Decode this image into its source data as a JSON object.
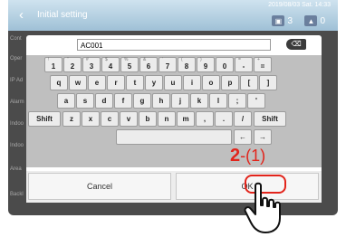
{
  "header": {
    "title": "Initial setting",
    "datetime": "2019/08/03 Sat. 14:33",
    "badge1_count": "3",
    "badge2_count": "0"
  },
  "sidebar": {
    "items": [
      "Cont",
      "Oper",
      "IP Ad",
      "Alarm",
      "Indoo",
      "Indoo",
      "Area",
      "Backl"
    ]
  },
  "keyboard": {
    "input_value": "AC001",
    "backspace_label": "⌫",
    "row1": [
      {
        "main": "1",
        "sub": "!"
      },
      {
        "main": "2",
        "sub": "\""
      },
      {
        "main": "3",
        "sub": "#"
      },
      {
        "main": "4",
        "sub": "$"
      },
      {
        "main": "5",
        "sub": "%"
      },
      {
        "main": "6",
        "sub": "&"
      },
      {
        "main": "7",
        "sub": "'"
      },
      {
        "main": "8",
        "sub": "("
      },
      {
        "main": "9",
        "sub": ")"
      },
      {
        "main": "0",
        "sub": ""
      },
      {
        "main": "-",
        "sub": "="
      },
      {
        "main": "=",
        "sub": "+"
      }
    ],
    "row2": [
      "q",
      "w",
      "e",
      "r",
      "t",
      "y",
      "u",
      "i",
      "o",
      "p",
      "[",
      "]"
    ],
    "row3": [
      "a",
      "s",
      "d",
      "f",
      "g",
      "h",
      "j",
      "k",
      "l",
      ";",
      "'"
    ],
    "row4": [
      "Shift",
      "z",
      "x",
      "c",
      "v",
      "b",
      "n",
      "m",
      ",",
      ".",
      "/",
      "Shift"
    ],
    "row5": [
      "←",
      "→"
    ]
  },
  "buttons": {
    "cancel": "Cancel",
    "ok": "OK"
  },
  "annotation": {
    "step_number": "2",
    "step_sub": "-(1)"
  },
  "colors": {
    "accent": "#e2241b"
  }
}
